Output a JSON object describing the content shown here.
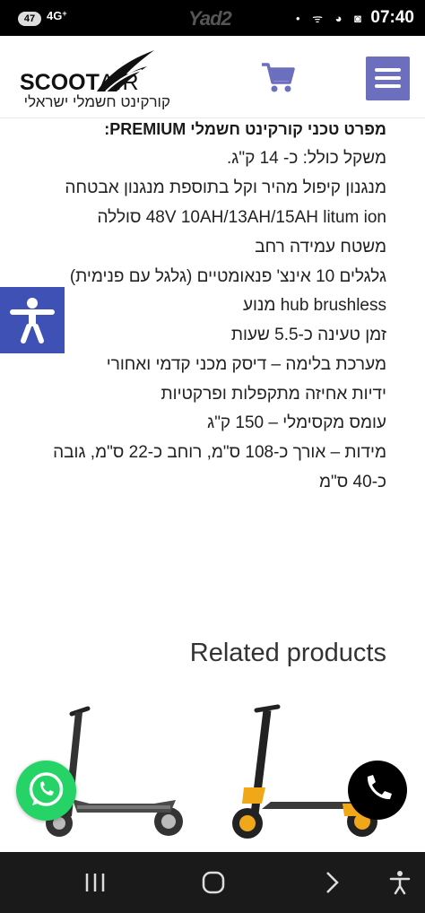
{
  "status_bar": {
    "notification_count": "47",
    "network": "4G",
    "network_suffix": "+",
    "watermark": "Yad2",
    "icons": "• ᯤ ◕ ◙",
    "time": "07:40"
  },
  "header": {
    "logo_word": "SCOOT",
    "logo_word_2": "AIR",
    "logo_tagline": "קורקינט חשמלי ישראלי"
  },
  "spec": {
    "title": "מפרט טכני קורקינט חשמלי PREMIUM:",
    "lines": [
      "משקל כולל: כ- 14 ק\"ג.",
      "מנגנון קיפול מהיר וקל בתוספת מנגנון אבטחה",
      "48V 10AH/13AH/15AH litum ion סוללה",
      "משטח עמידה רחב",
      "גלגלים 10 אינצ' פנאומטיים (גלגל עם פנימית)",
      "hub brushless מנוע",
      "זמן טעינה כ-5.5 שעות",
      "מערכת בלימה – דיסק מכני קדמי ואחורי",
      "ידיות אחיזה מתקפלות ופרקטיות",
      "עומס מקסימלי – 150 ק\"ג",
      "מידות – אורך כ-108 ס\"מ, רוחב כ-22 ס\"מ, גובה",
      "כ-40 ס\"מ"
    ]
  },
  "related": {
    "title": "Related products"
  },
  "colors": {
    "menu": "#6b6fbe",
    "accessibility": "#3f51b5",
    "whatsapp": "#25d366",
    "scooter_accent": "#f0a818"
  },
  "icons": {
    "cart": "cart-icon",
    "menu": "hamburger-icon",
    "accessibility": "accessibility-icon",
    "whatsapp": "whatsapp-icon",
    "phone": "phone-icon",
    "recents": "recents-icon",
    "home": "home-icon",
    "back": "back-icon",
    "nav_accessibility": "accessibility-icon"
  }
}
